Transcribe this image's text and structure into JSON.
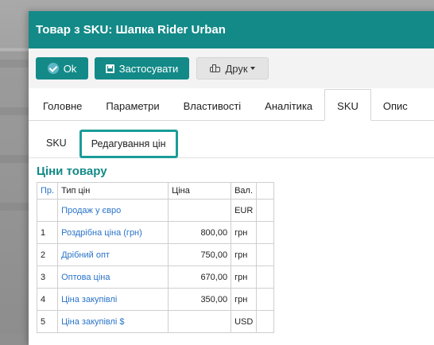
{
  "window": {
    "title": "Товар з SKU: Шапка Rider Urban"
  },
  "toolbar": {
    "ok_label": "Ok",
    "apply_label": "Застосувати",
    "print_label": "Друк"
  },
  "tabs": [
    {
      "label": "Головне"
    },
    {
      "label": "Параметри"
    },
    {
      "label": "Властивості"
    },
    {
      "label": "Аналітика"
    },
    {
      "label": "SKU",
      "active": true
    },
    {
      "label": "Опис"
    }
  ],
  "subtabs": [
    {
      "label": "SKU"
    },
    {
      "label": "Редагування цін",
      "active": true
    }
  ],
  "prices": {
    "title": "Ціни товару",
    "columns": {
      "num": "Пр.",
      "type": "Тип цін",
      "price": "Ціна",
      "currency": "Вал."
    },
    "rows": [
      {
        "num": "",
        "type": "Продаж у євро",
        "price": "",
        "currency": "EUR"
      },
      {
        "num": "1",
        "type": "Роздрібна ціна (грн)",
        "price": "800,00",
        "currency": "грн"
      },
      {
        "num": "2",
        "type": "Дрібний опт",
        "price": "750,00",
        "currency": "грн"
      },
      {
        "num": "3",
        "type": "Оптова ціна",
        "price": "670,00",
        "currency": "грн"
      },
      {
        "num": "4",
        "type": "Ціна закупівлі",
        "price": "350,00",
        "currency": "грн"
      },
      {
        "num": "5",
        "type": "Ціна закупівлі $",
        "price": "",
        "currency": "USD"
      }
    ]
  },
  "colors": {
    "accent": "#138a88",
    "link": "#2a74c9"
  }
}
